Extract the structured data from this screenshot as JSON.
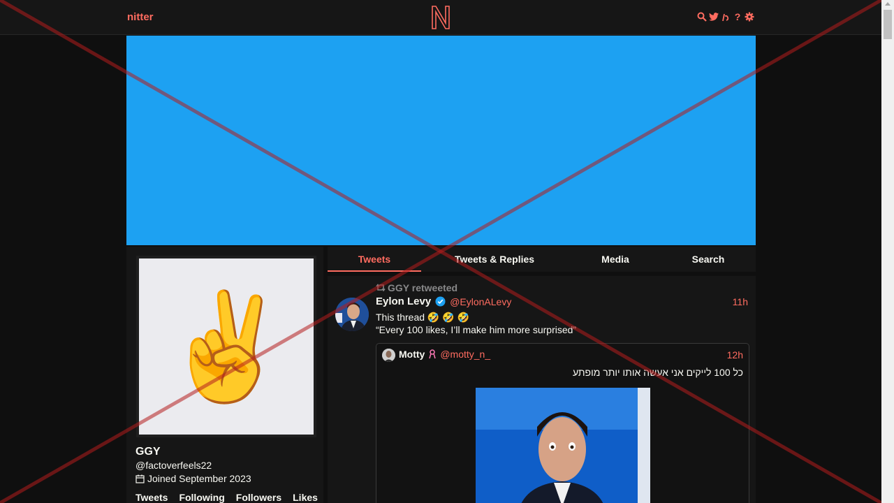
{
  "nav": {
    "brand": "nitter",
    "icons": [
      "search-icon",
      "twitter-bird-icon",
      "rss-icon",
      "help-icon",
      "settings-gear-icon"
    ],
    "help_glyph": "?"
  },
  "profile": {
    "avatar_emoji": "✌️",
    "name": "GGY",
    "handle": "@factoverfeels22",
    "joined": "Joined September 2023",
    "stats": [
      "Tweets",
      "Following",
      "Followers",
      "Likes"
    ]
  },
  "tabs": [
    {
      "label": "Tweets",
      "active": true
    },
    {
      "label": "Tweets & Replies",
      "active": false
    },
    {
      "label": "Media",
      "active": false
    },
    {
      "label": "Search",
      "active": false
    }
  ],
  "tweet": {
    "retweet_label": "GGY retweeted",
    "fullname": "Eylon Levy",
    "username": "@EylonALevy",
    "date": "11h",
    "line1": "This thread 🤣 🤣 🤣",
    "line2": "“Every 100 likes, I’ll make him more surprised”",
    "quote": {
      "fullname": "Motty",
      "username": "@motty_n_",
      "date": "12h",
      "text": "כל 100 לייקים אני אעשה אותו יותר מופתע"
    }
  },
  "colors": {
    "accent": "#ff6c60",
    "banner": "#1da1f2",
    "background": "#0f0f0f",
    "panel": "#161616",
    "overlay_x": "#b41e1e"
  }
}
